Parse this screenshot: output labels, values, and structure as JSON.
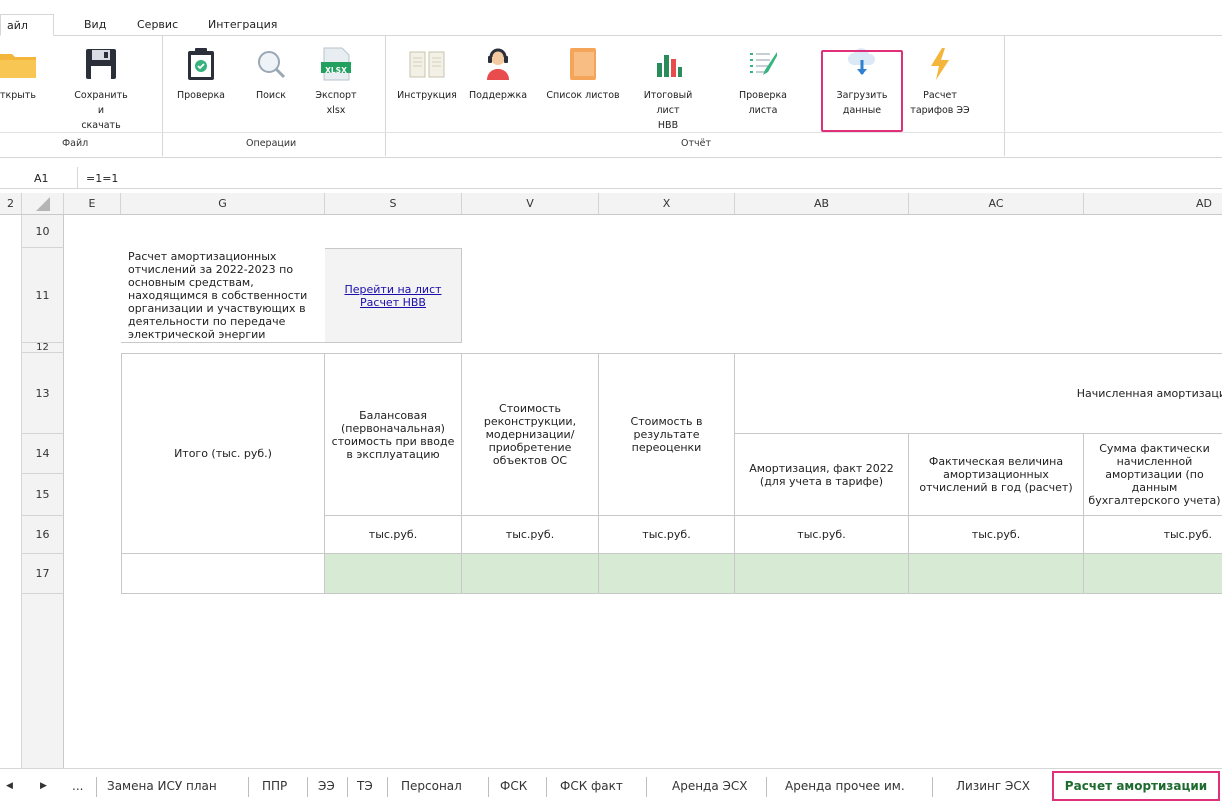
{
  "menu": {
    "file": "айл",
    "view": "Вид",
    "service": "Сервис",
    "integration": "Интеграция"
  },
  "ribbon": {
    "buttons": [
      {
        "label": "ткрыть",
        "icon": "folder-icon"
      },
      {
        "label": "Сохранить и\nскачать",
        "icon": "save-icon"
      },
      {
        "label": "Проверка",
        "icon": "check-clipboard-icon"
      },
      {
        "label": "Поиск",
        "icon": "search-icon"
      },
      {
        "label": "Экспорт\nxlsx",
        "icon": "xlsx-icon",
        "badge": "XLSX"
      },
      {
        "label": "Инструкция",
        "icon": "book-icon"
      },
      {
        "label": "Поддержка",
        "icon": "support-agent-icon"
      },
      {
        "label": "Список листов",
        "icon": "sheet-list-icon"
      },
      {
        "label": "Итоговый лист\nНВВ",
        "icon": "bar-chart-icon"
      },
      {
        "label": "Проверка\nлиста",
        "icon": "checklist-icon"
      },
      {
        "label": "Загрузить\nданные",
        "icon": "cloud-download-icon"
      },
      {
        "label": "Расчет\nтарифов ЭЭ",
        "icon": "lightning-icon"
      }
    ],
    "groups": {
      "file": "Файл",
      "operations": "Операции",
      "report": "Отчёт"
    }
  },
  "formula_bar": {
    "cell_ref": "A1",
    "formula": "=1=1"
  },
  "columns": {
    "c2": "2",
    "e": "E",
    "g": "G",
    "s": "S",
    "v": "V",
    "x": "X",
    "ab": "AB",
    "ac": "AC",
    "ad": "AD"
  },
  "rows": {
    "r10": "10",
    "r11": "11",
    "r12": "12",
    "r13": "13",
    "r14": "14",
    "r15": "15",
    "r16": "16",
    "r17": "17"
  },
  "sheet": {
    "title_text": "Расчет амортизационных отчислений за 2022-2023 по основным средствам, находящимся в собственности организации и участвующих в деятельности по передаче электрической энергии",
    "link_text": "Перейти на лист Расчет НВВ",
    "total_label": "Итого (тыс. руб.)",
    "h_balance": "Балансовая (первоначальная) стоимость при вводе в эксплуатацию",
    "h_reconstruction": "Стоимость реконструкции, модернизации/приобретение объектов ОС",
    "h_revaluation": "Стоимость в результате переоценки",
    "h_accrued": "Начисленная амортизаци",
    "h_amort_fact": "Амортизация, факт 2022 (для учета в тарифе)",
    "h_actual_value": "Фактическая величина амортизационных отчислений в год (расчет)",
    "h_sum_actual": "Сумма фактически начисленной амортизации (по данным бухгалтерского учета)",
    "unit": "тыс.руб."
  },
  "tabs": {
    "items": [
      "Замена ИСУ план",
      "ППР",
      "ЭЭ",
      "ТЭ",
      "Персонал",
      "ФСК",
      "ФСК факт",
      "Аренда ЭСХ",
      "Аренда прочее им.",
      "Лизинг ЭСХ"
    ],
    "active": "Расчет амортизации",
    "more": "..."
  },
  "colors": {
    "accent": "#e0307a",
    "green_fill": "#d7ead4",
    "link": "#1a0dab"
  }
}
